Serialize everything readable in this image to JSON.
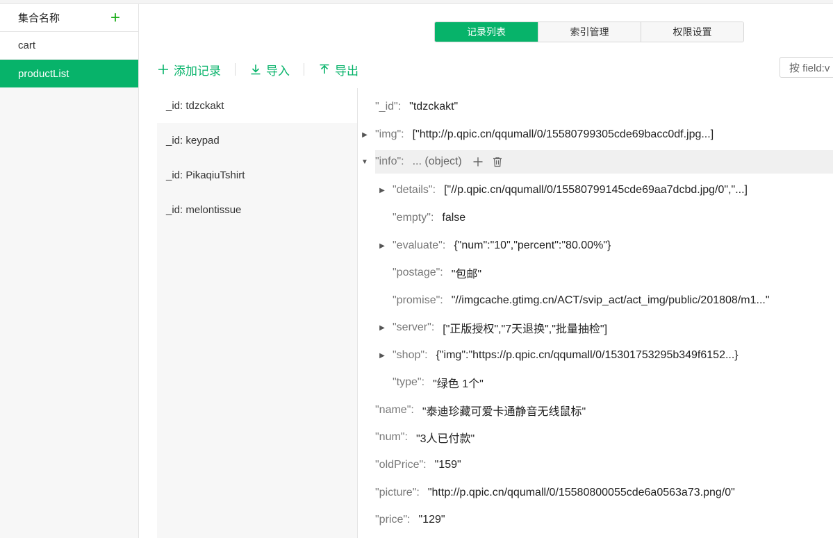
{
  "sidebar": {
    "title": "集合名称",
    "collections": [
      "cart",
      "productList"
    ]
  },
  "tabs": [
    "记录列表",
    "索引管理",
    "权限设置"
  ],
  "toolbar": {
    "add_label": "添加记录",
    "import_label": "导入",
    "export_label": "导出"
  },
  "search": {
    "placeholder": "按 field:v"
  },
  "records": [
    "_id: tdzckakt",
    "_id: keypad",
    "_id: PikaqiuTshirt",
    "_id: melontissue"
  ],
  "detail": {
    "id_key": "\"_id\"",
    "id_val": "\"tdzckakt\"",
    "img_key": "\"img\"",
    "img_val": "[\"http://p.qpic.cn/qqumall/0/15580799305cde69bacc0df.jpg...]",
    "info_key": "\"info\"",
    "info_val": "... (object)",
    "details_key": "\"details\"",
    "details_val": "[\"//p.qpic.cn/qqumall/0/15580799145cde69aa7dcbd.jpg/0\",\"...]",
    "empty_key": "\"empty\"",
    "empty_val": "false",
    "evaluate_key": "\"evaluate\"",
    "evaluate_val": "{\"num\":\"10\",\"percent\":\"80.00%\"}",
    "postage_key": "\"postage\"",
    "postage_val": "\"包邮\"",
    "promise_key": "\"promise\"",
    "promise_val": "\"//imgcache.gtimg.cn/ACT/svip_act/act_img/public/201808/m1...\"",
    "server_key": "\"server\"",
    "server_val": "[\"正版授权\",\"7天退换\",\"批量抽检\"]",
    "shop_key": "\"shop\"",
    "shop_val": "{\"img\":\"https://p.qpic.cn/qqumall/0/15301753295b349f6152...}",
    "type_key": "\"type\"",
    "type_val": "\"绿色 1个\"",
    "name_key": "\"name\"",
    "name_val": "\"泰迪珍藏可爱卡通静音无线鼠标\"",
    "num_key": "\"num\"",
    "num_val": "\"3人已付款\"",
    "oldPrice_key": "\"oldPrice\"",
    "oldPrice_val": "\"159\"",
    "picture_key": "\"picture\"",
    "picture_val": "\"http://p.qpic.cn/qqumall/0/15580800055cde6a0563a73.png/0\"",
    "price_key": "\"price\"",
    "price_val": "\"129\""
  },
  "colors": {
    "accent": "#07b36a"
  }
}
